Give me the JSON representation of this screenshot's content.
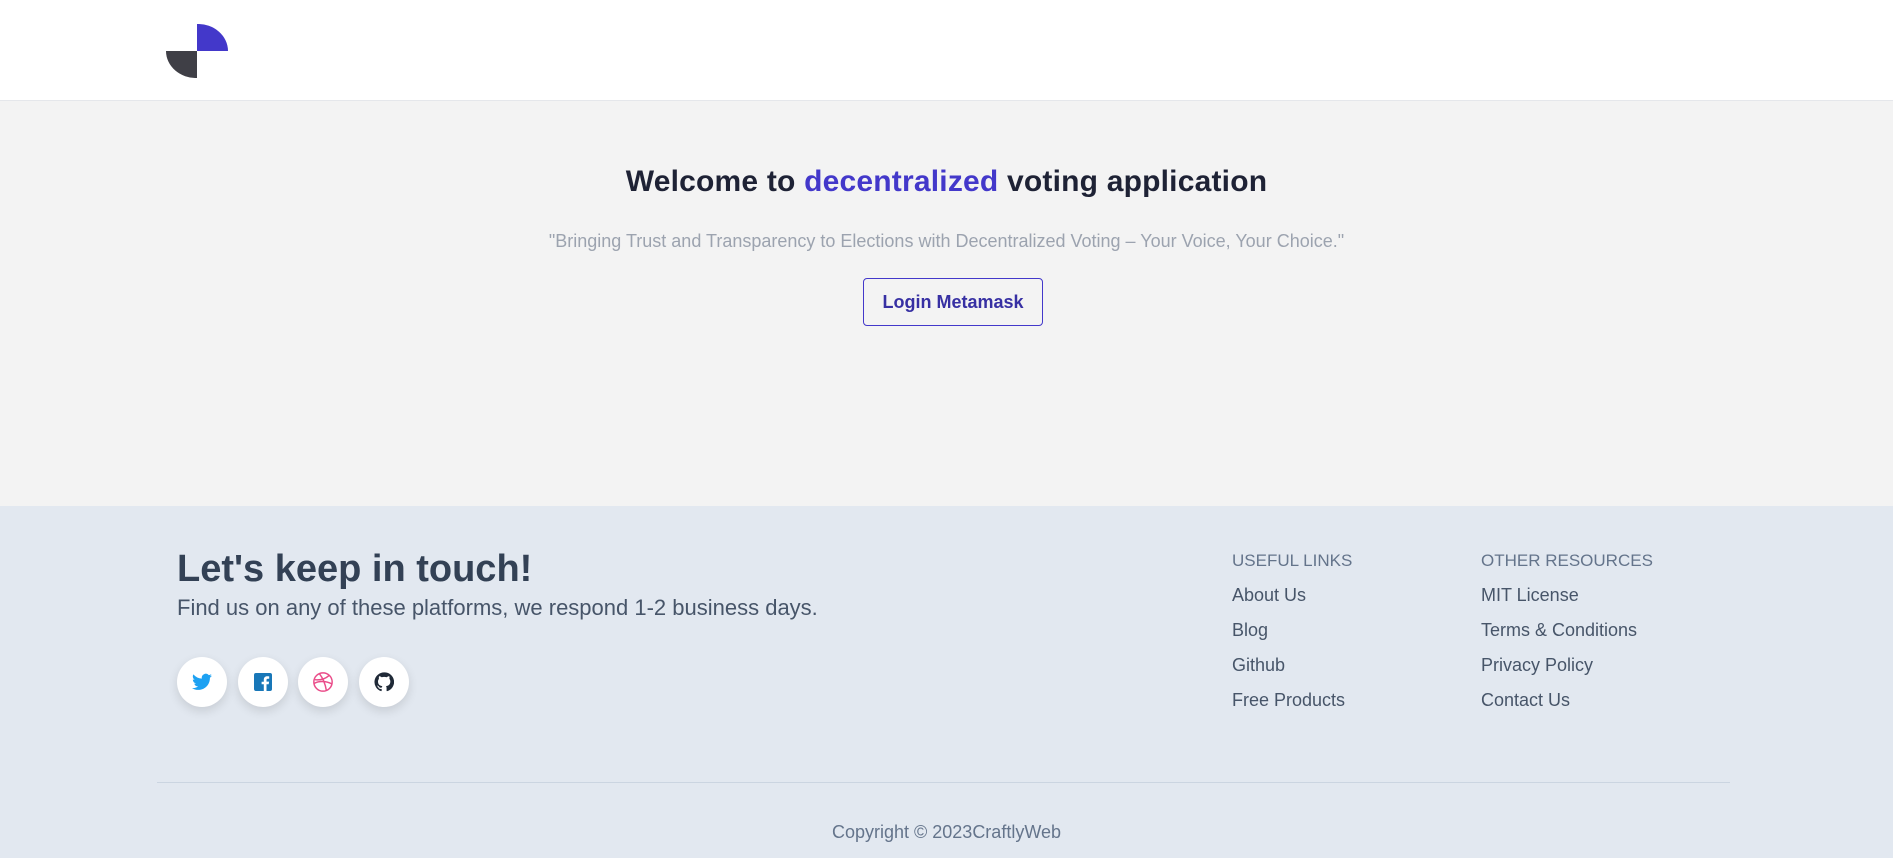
{
  "nav": {
    "logo_icon": "quarter-circles-logo"
  },
  "hero": {
    "title_prefix": "Welcome to ",
    "title_accent": "decentralized",
    "title_suffix": " voting application",
    "tagline": "\"Bringing Trust and Transparency to Elections with Decentralized Voting – Your Voice, Your Choice.\"",
    "login_label": "Login Metamask"
  },
  "footer": {
    "heading": "Let's keep in touch!",
    "subheading": "Find us on any of these platforms, we respond 1-2 business days.",
    "socials": [
      {
        "icon": "twitter-icon",
        "color": "#1da1f2"
      },
      {
        "icon": "facebook-icon",
        "color": "#1877b8"
      },
      {
        "icon": "dribbble-icon",
        "color": "#ea4c89"
      },
      {
        "icon": "github-icon",
        "color": "#1f2937"
      }
    ],
    "useful_links": {
      "title": "USEFUL LINKS",
      "items": [
        "About Us",
        "Blog",
        "Github",
        "Free Products"
      ]
    },
    "other_resources": {
      "title": "OTHER RESOURCES",
      "items": [
        "MIT License",
        "Terms & Conditions",
        "Privacy Policy",
        "Contact Us"
      ]
    },
    "copyright": "Copyright © 2023CraftlyWeb"
  },
  "colors": {
    "accent": "#4338ca",
    "hero_bg": "#f3f3f3",
    "footer_bg": "#e2e8f0"
  }
}
